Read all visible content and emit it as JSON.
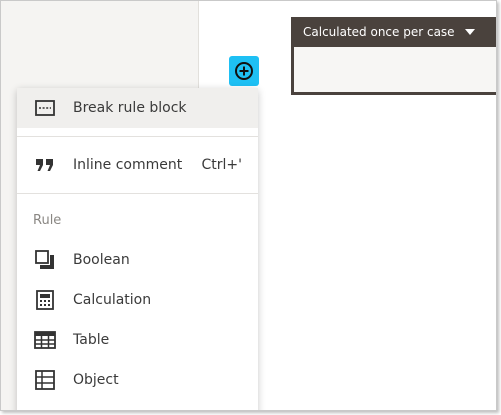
{
  "rule_header": {
    "scope_label": "Calculated once per case"
  },
  "menu": {
    "items_top": [
      {
        "label": "Break rule block",
        "icon": "break-rule-icon",
        "shortcut": ""
      },
      {
        "label": "Inline comment",
        "icon": "quote-icon",
        "shortcut": "Ctrl+'"
      }
    ],
    "section_label": "Rule",
    "rule_items": [
      {
        "label": "Boolean",
        "icon": "boolean-icon"
      },
      {
        "label": "Calculation",
        "icon": "calculator-icon"
      },
      {
        "label": "Table",
        "icon": "table-icon"
      },
      {
        "label": "Object",
        "icon": "object-icon"
      }
    ]
  },
  "colors": {
    "accent": "#1ec0f4",
    "header_bg": "#4a423d",
    "left_pane_bg": "#f5f4f2"
  }
}
